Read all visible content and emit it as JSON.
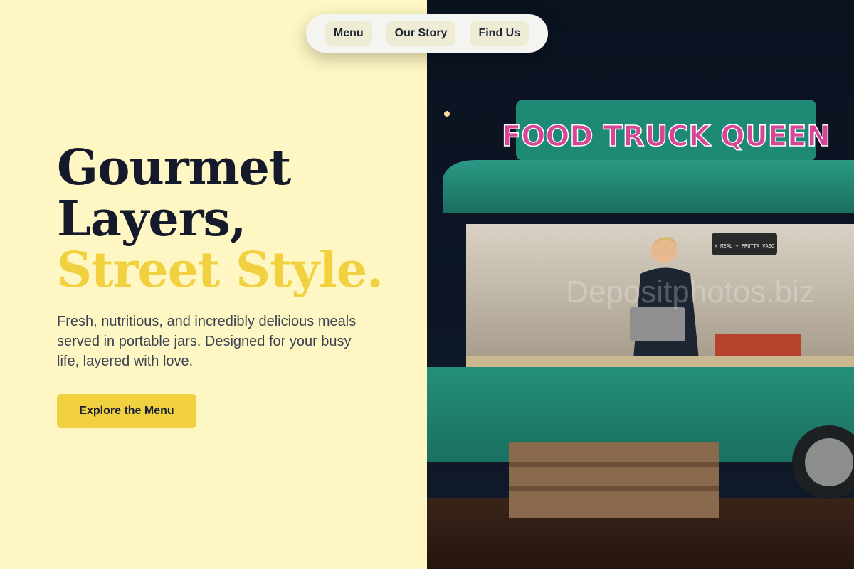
{
  "nav": {
    "items": [
      {
        "label": "Menu"
      },
      {
        "label": "Our Story"
      },
      {
        "label": "Find Us"
      }
    ]
  },
  "hero": {
    "headline_line1": "Gourmet",
    "headline_line2": "Layers,",
    "headline_accent": "Street Style.",
    "subtext": "Fresh, nutritious, and incredibly delicious meals served in portable jars. Designed for your busy life, layered with love.",
    "cta_label": "Explore the Menu"
  },
  "photo": {
    "sign_text": "FOOD TRUCK QUEEN",
    "chalkboard_text": "+ MEAL + FRUTTA VASO",
    "watermark": "Depositphotos.biz"
  },
  "colors": {
    "background": "#FEF7C3",
    "accent": "#F2D140",
    "headline": "#141a2b",
    "truck": "#1f8a78"
  }
}
